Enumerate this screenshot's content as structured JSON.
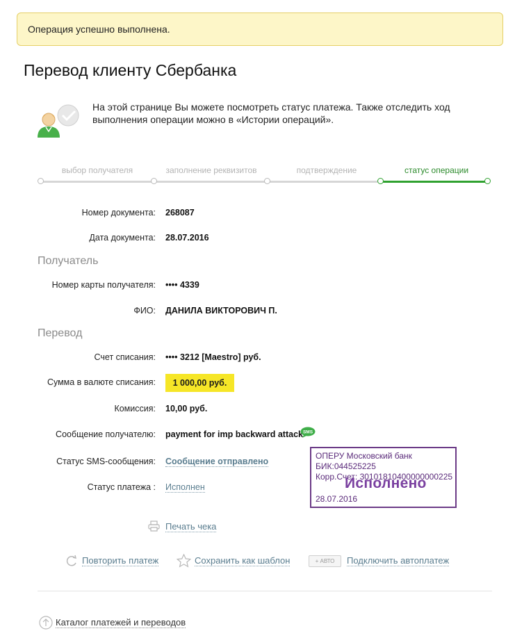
{
  "alert": {
    "message": "Операция успешно выполнена."
  },
  "page": {
    "title": "Перевод клиенту Сбербанка",
    "intro": "На этой странице Вы можете посмотреть статус платежа. Также отследить ход выполнения операции можно в «Истории операций»."
  },
  "steps": [
    {
      "label": "выбор получателя",
      "active": false
    },
    {
      "label": "заполнение реквизитов",
      "active": false
    },
    {
      "label": "подтверждение",
      "active": false
    },
    {
      "label": "статус операции",
      "active": true
    }
  ],
  "document": {
    "number_label": "Номер документа:",
    "number_value": "268087",
    "date_label": "Дата документа:",
    "date_value": "28.07.2016"
  },
  "recipient": {
    "section_title": "Получатель",
    "card_label": "Номер карты получателя:",
    "card_value": "•••• 4339",
    "name_label": "ФИО:",
    "name_value": "ДАНИЛА ВИКТОРОВИЧ П."
  },
  "transfer": {
    "section_title": "Перевод",
    "account_label": "Счет списания:",
    "account_value": "•••• 3212  [Maestro]  руб.",
    "amount_label": "Сумма в валюте списания:",
    "amount_value": "1 000,00  руб.",
    "fee_label": "Комиссия:",
    "fee_value": "10,00 руб.",
    "message_label": "Сообщение получателю:",
    "message_value": "payment for imp backward attack",
    "sms_badge": "SMS",
    "sms_status_label": "Статус SMS-сообщения:",
    "sms_status_value": "Сообщение отправлено",
    "payment_status_label": "Статус платежа :",
    "payment_status_value": "Исполнен"
  },
  "stamp": {
    "line1": "ОПЕРУ Московский банк",
    "line2": "БИК:044525225",
    "line3": "Корр.Счет: 30101810400000000225",
    "status": "Исполнено",
    "date": "28.07.2016"
  },
  "actions": {
    "print_receipt": "Печать чека",
    "repeat_payment": "Повторить платеж",
    "save_template": "Сохранить как шаблон",
    "auto_badge": "+ АВТО",
    "connect_autopay": "Подключить автоплатеж",
    "catalog": "Каталог платежей и переводов"
  },
  "colors": {
    "accent_green": "#2fa12f",
    "highlight_yellow": "#f6e627",
    "alert_bg": "#fdf6c8",
    "stamp_purple": "#6b3a86",
    "link": "#5a7d8f"
  },
  "icons": [
    "user-avatar-icon",
    "sberbank-logo-icon",
    "sms-icon",
    "printer-icon",
    "repeat-icon",
    "star-icon",
    "auto-icon",
    "up-arrow-icon"
  ]
}
